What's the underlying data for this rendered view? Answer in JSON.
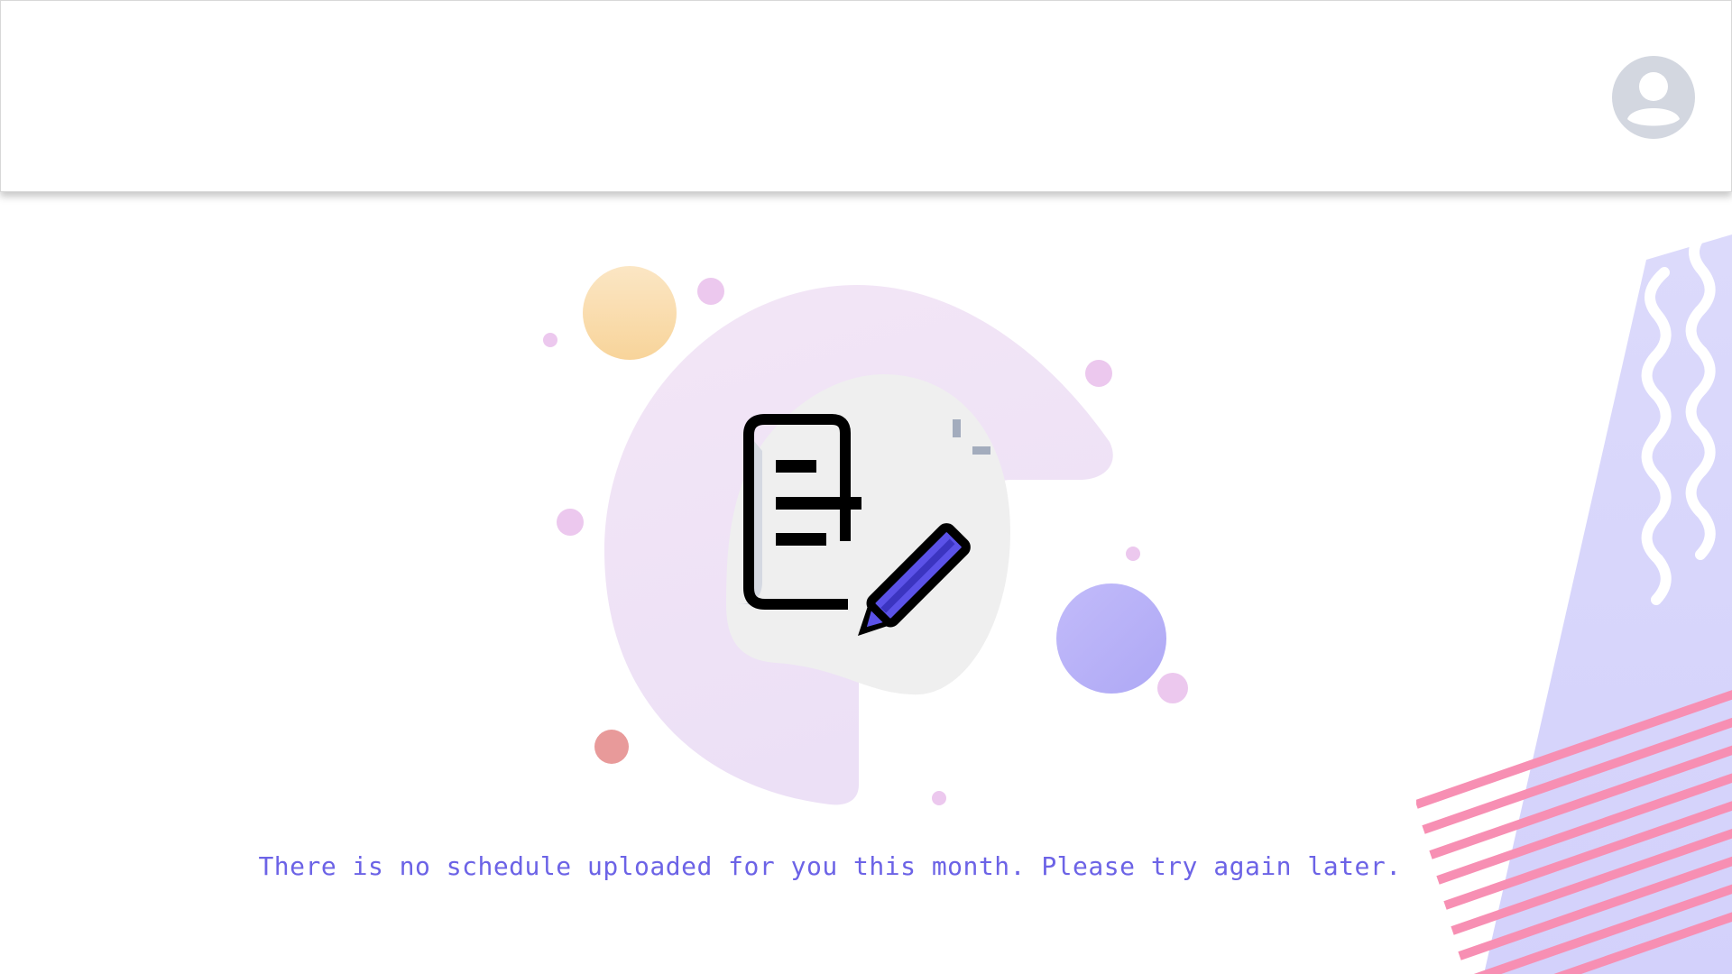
{
  "header": {
    "profile_icon": "user-circle-icon"
  },
  "empty_state": {
    "illustration_icon": "document-edit-icon",
    "message": "There is no schedule uploaded for you this month. Please try again later."
  },
  "colors": {
    "message_text": "#6c63e6",
    "accent_purple": "#6c63ff",
    "blob_pink": "#f3e3f5",
    "stripe_pink": "#f78fb3",
    "panel_lavender": "#d9d7fb",
    "avatar_grey": "#d3d7e0"
  }
}
